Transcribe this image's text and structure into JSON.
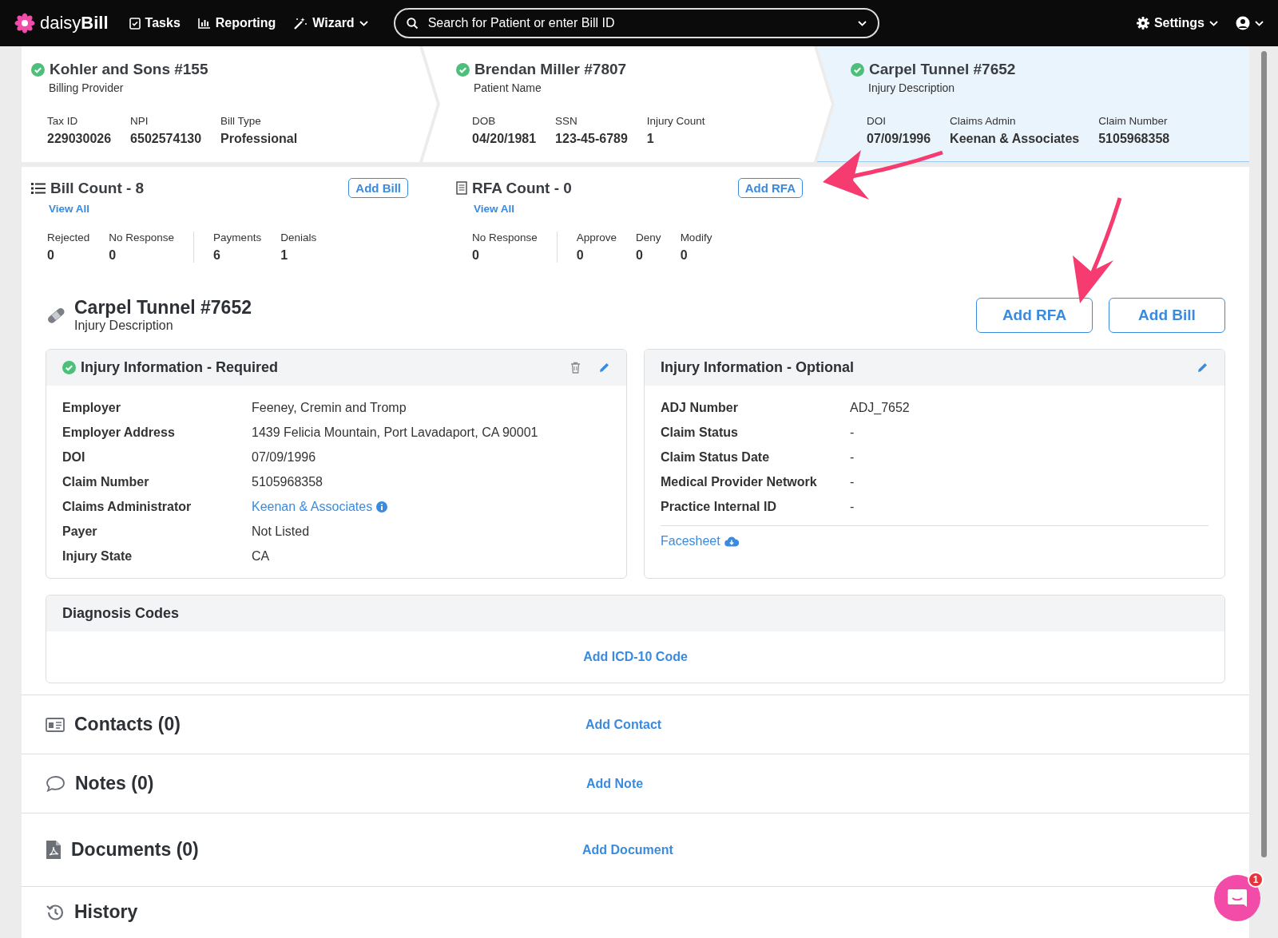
{
  "nav": {
    "logo_light": "daisy",
    "logo_bold": "Bill",
    "items": [
      {
        "label": "Tasks",
        "kind": "tasks",
        "caret": false
      },
      {
        "label": "Reporting",
        "kind": "reporting",
        "caret": false
      },
      {
        "label": "Wizard",
        "kind": "wizard",
        "caret": true
      }
    ],
    "search": {
      "placeholder": "Search for Patient or enter Bill ID"
    },
    "settings": "Settings"
  },
  "summary_cards": [
    {
      "title": "Kohler and Sons #155",
      "subtitle": "Billing Provider",
      "verified": true,
      "selected": false,
      "fields": [
        {
          "label": "Tax ID",
          "value": "229030026"
        },
        {
          "label": "NPI",
          "value": "6502574130"
        },
        {
          "label": "Bill Type",
          "value": "Professional"
        }
      ]
    },
    {
      "title": "Brendan Miller #7807",
      "subtitle": "Patient Name",
      "verified": true,
      "selected": false,
      "fields": [
        {
          "label": "DOB",
          "value": "04/20/1981"
        },
        {
          "label": "SSN",
          "value": "123-45-6789"
        },
        {
          "label": "Injury Count",
          "value": "1"
        }
      ]
    },
    {
      "title": "Carpel Tunnel #7652",
      "subtitle": "Injury Description",
      "verified": true,
      "selected": true,
      "fields": [
        {
          "label": "DOI",
          "value": "07/09/1996"
        },
        {
          "label": "Claims Admin",
          "value": "Keenan & Associates"
        },
        {
          "label": "Claim Number",
          "value": "5105968358"
        }
      ]
    }
  ],
  "count_cards": [
    {
      "kind": "list",
      "title": "Bill Count - 8",
      "button": "Add Bill",
      "link": "View All",
      "groups": [
        [
          {
            "label": "Rejected",
            "value": "0"
          },
          {
            "label": "No Response",
            "value": "0"
          }
        ],
        [
          {
            "label": "Payments",
            "value": "6"
          },
          {
            "label": "Denials",
            "value": "1"
          }
        ]
      ]
    },
    {
      "kind": "form",
      "title": "RFA Count - 0",
      "button": "Add RFA",
      "link": "View All",
      "groups": [
        [
          {
            "label": "No Response",
            "value": "0"
          }
        ],
        [
          {
            "label": "Approve",
            "value": "0"
          },
          {
            "label": "Deny",
            "value": "0"
          },
          {
            "label": "Modify",
            "value": "0"
          }
        ]
      ]
    }
  ],
  "injury": {
    "title": "Carpel Tunnel #7652",
    "subtitle": "Injury Description",
    "buttons": [
      "Add RFA",
      "Add Bill"
    ]
  },
  "required_panel": {
    "title": "Injury Information - Required",
    "verified": true,
    "rows": [
      {
        "label": "Employer",
        "value": "Feeney, Cremin and Tromp",
        "kind": "text"
      },
      {
        "label": "Employer Address",
        "value": "1439 Felicia Mountain, Port Lavadaport, CA 90001",
        "kind": "text"
      },
      {
        "label": "DOI",
        "value": "07/09/1996",
        "kind": "text"
      },
      {
        "label": "Claim Number",
        "value": "5105968358",
        "kind": "text"
      },
      {
        "label": "Claims Administrator",
        "value": "Keenan & Associates",
        "kind": "link"
      },
      {
        "label": "Payer",
        "value": "Not Listed",
        "kind": "text"
      },
      {
        "label": "Injury State",
        "value": "CA",
        "kind": "text"
      }
    ]
  },
  "optional_panel": {
    "title": "Injury Information - Optional",
    "rows": [
      {
        "label": "ADJ Number",
        "value": "ADJ_7652"
      },
      {
        "label": "Claim Status",
        "value": "-"
      },
      {
        "label": "Claim Status Date",
        "value": "-"
      },
      {
        "label": "Medical Provider Network",
        "value": "-"
      },
      {
        "label": "Practice Internal ID",
        "value": "-"
      }
    ],
    "link": "Facesheet"
  },
  "diagnosis": {
    "title": "Diagnosis Codes",
    "add": "Add ICD-10 Code"
  },
  "sections": [
    {
      "kind": "contacts",
      "title": "Contacts (0)",
      "add": "Add Contact"
    },
    {
      "kind": "notes",
      "title": "Notes (0)",
      "add": "Add Note"
    },
    {
      "kind": "documents",
      "title": "Documents (0)",
      "add": "Add Document"
    }
  ],
  "history": {
    "title": "History"
  },
  "chat": {
    "badge": "1"
  }
}
